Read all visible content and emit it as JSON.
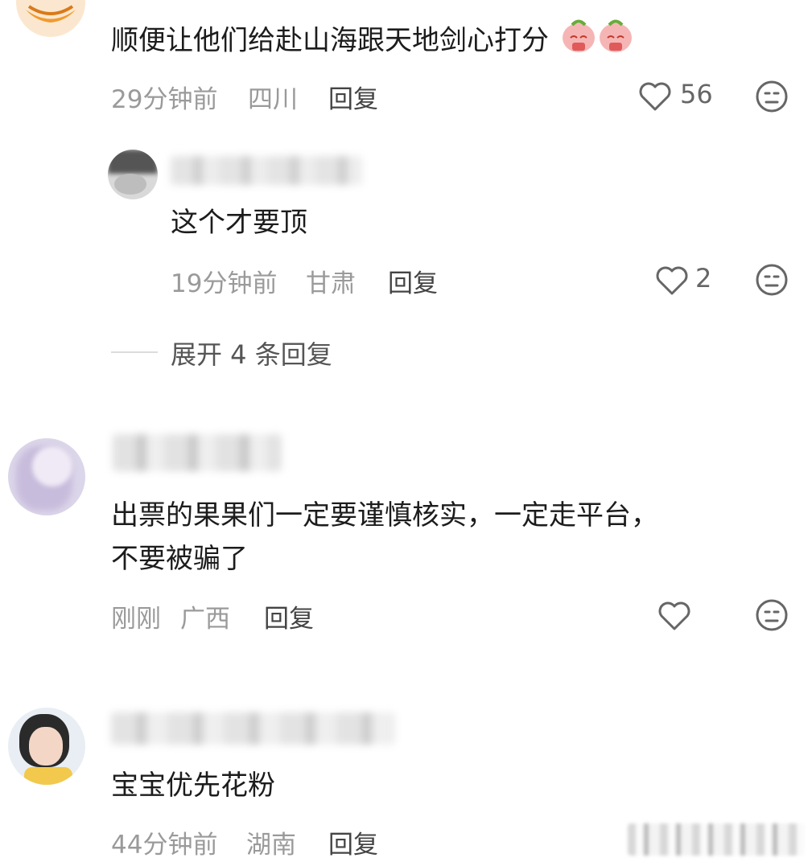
{
  "comments": [
    {
      "text": "顺便让他们给赴山海跟天地剑心打分",
      "time": "29分钟前",
      "location": "四川",
      "reply_label": "回复",
      "likes": "56"
    },
    {
      "text": "这个才要顶",
      "time": "19分钟前",
      "location": "甘肃",
      "reply_label": "回复",
      "likes": "2"
    },
    {
      "text_line1": "出票的果果们一定要谨慎核实，一定走平台，",
      "text_line2": "不要被骗了",
      "time": "刚刚",
      "location": "广西",
      "reply_label": "回复",
      "likes": ""
    },
    {
      "text": "宝宝优先花粉",
      "time": "44分钟前",
      "location": "湖南",
      "reply_label": "回复"
    }
  ],
  "expand_replies": "展开 4 条回复",
  "icons": {
    "like": "heart-outline-icon",
    "dislike": "meh-face-icon",
    "emoji": "pig-pray-emoji"
  },
  "colors": {
    "meta": "#9a9a9a",
    "text": "#1c1c1c",
    "avatar_orange": "#f29a2e"
  }
}
